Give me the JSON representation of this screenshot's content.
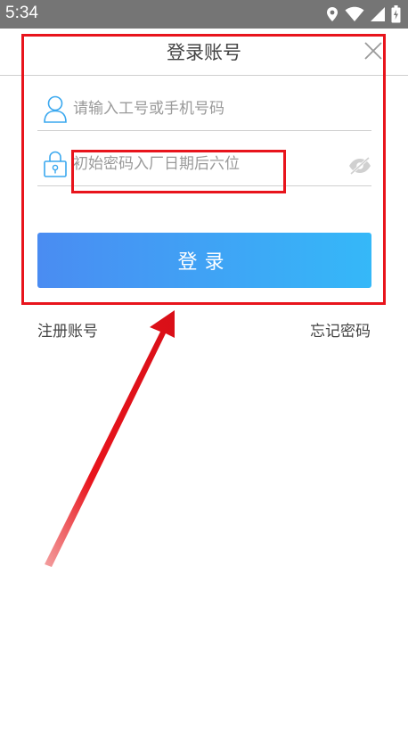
{
  "status_bar": {
    "time": "5:34",
    "icons": [
      "location-icon",
      "wifi-icon",
      "signal-icon",
      "battery-icon"
    ]
  },
  "header": {
    "title": "登录账号",
    "close_icon": "close-icon"
  },
  "form": {
    "username": {
      "placeholder": "请输入工号或手机号码",
      "value": "",
      "icon": "user-icon"
    },
    "password": {
      "placeholder": "初始密码入厂日期后六位",
      "value": "",
      "icon": "lock-icon",
      "toggle_icon": "eye-off-icon"
    },
    "login_label": "登录"
  },
  "links": {
    "register": "注册账号",
    "forgot_password": "忘记密码"
  },
  "colors": {
    "status_bar": "#757575",
    "button_start": "#4a8cf2",
    "button_end": "#35b8f8",
    "icon_accent": "#3aa8ef",
    "annotation": "#e8141c"
  }
}
